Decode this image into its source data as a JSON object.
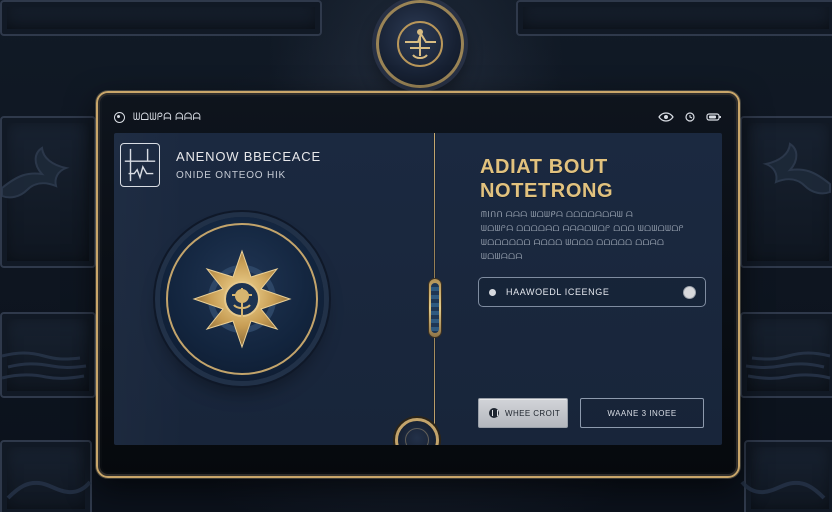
{
  "status_bar": {
    "left_text": "ᗯᗝᗯᑭᗩ ᗩᗩᗩ",
    "right_icons": [
      "eye-icon",
      "clock-icon",
      "battery-icon"
    ]
  },
  "left_panel": {
    "title": "ANENOW BBECEACE",
    "subtitle": "ONIDE ONTEOO HIK",
    "brand_icon": "waveform-grid-icon",
    "emblem_icon": "compass-sun-icon"
  },
  "right_panel": {
    "headline_line_1": "ADIAT BOUT",
    "headline_line_2": "NOTETRONG",
    "body_lines": [
      "ᗰIᑎᑎ ᗩᗩᗩ ᗯᗝᗯᑭᗩ ᗝᗝᗝᗝᗩᗝᗩᗯ ᗩ",
      "ᗯᗝᗯᑭᗩ ᗝᗝᗝᗝᗩᗝ ᗩᗩᗩᗝᗯᗝᑭ ᗝᗝᗝ ᗯᗝᗯᗝᗯᗝᑭ",
      "ᗯᗝᗝᗝᗝᗝᗝ ᗩᗝᗝᗝ ᗯᗝᗝᗝ ᗝᗝᗝᗝᗝ ᗝᗝᗩᗝ",
      "ᗯᗝᗯᗩᗝᗩ"
    ],
    "toggle_label": "HAAWOEDL ICEENGE",
    "primary_button": "WHEE CROIT",
    "secondary_button": "WAANE 3 INOEE"
  },
  "theme": {
    "gold": "#c9a66a",
    "navy": "#1b2940",
    "text_primary": "#e8e8eb",
    "text_muted": "#9aa4b2"
  }
}
